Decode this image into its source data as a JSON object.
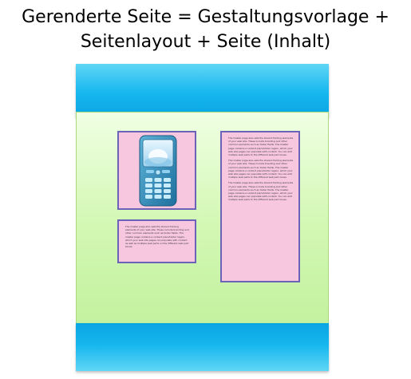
{
  "title": {
    "line1": "Gerenderte Seite = Gestaltungsvorlage +",
    "line2": "Seitenlayout + Seite (Inhalt)"
  },
  "content_boxes": {
    "phone_box": {
      "icon": "mobile-phone-icon"
    },
    "small_text": [
      "The master page also sets the shared framing elements of your web site. These include branding and other common elements such as footer fields. The master page contains a content placeholder region, which your web site pages can populate with content as well as multiple web parts on the different web part zones."
    ],
    "tall_text": [
      "The master page also sets the shared framing elements of your web site. These include branding and other common elements such as footer fields. The master page contains a content placeholder region, which your web site pages can populate with content. You can add multiple web parts to the different web part zones.",
      "The master page also sets the shared framing elements of your web site. These include branding and other common elements such as footer fields. The master page contains a content placeholder region, which your web site pages can populate with content. You can add multiple web parts to the different web part zones.",
      "The master page also sets the shared framing elements of your web site. These include branding and other common elements such as footer fields. The master page contains a content placeholder region, which your web site pages can populate with content. You can add multiple web parts to the different web part zones."
    ]
  },
  "colors": {
    "band": "#16b6ee",
    "content_area": "#d4f8b6",
    "box_fill": "#f7c6df",
    "box_border": "#6b63b8"
  }
}
